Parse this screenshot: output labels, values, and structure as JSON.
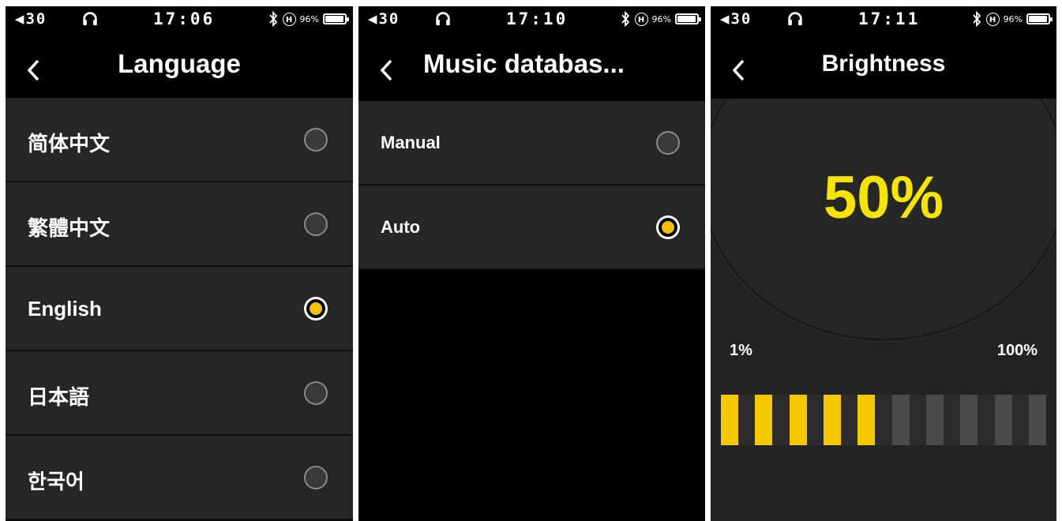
{
  "screens": [
    {
      "status": {
        "volume": "◀30",
        "time": "17:06",
        "battery_pct": "96%",
        "battery_level": 0.96
      },
      "title": "Language",
      "options": [
        {
          "label": "简体中文",
          "selected": false
        },
        {
          "label": "繁體中文",
          "selected": false
        },
        {
          "label": "English",
          "selected": true
        },
        {
          "label": "日本語",
          "selected": false
        },
        {
          "label": "한국어",
          "selected": false
        }
      ]
    },
    {
      "status": {
        "volume": "◀30",
        "time": "17:10",
        "battery_pct": "96%",
        "battery_level": 0.96
      },
      "title": "Music databas...",
      "options": [
        {
          "label": "Manual",
          "selected": false
        },
        {
          "label": "Auto",
          "selected": true
        }
      ]
    },
    {
      "status": {
        "volume": "◀30",
        "time": "17:11",
        "battery_pct": "96%",
        "battery_level": 0.96
      },
      "title": "Brightness",
      "value_label": "50%",
      "min_label": "1%",
      "max_label": "100%",
      "level_segments_total": 10,
      "level_segments_on": 5
    }
  ],
  "colors": {
    "accent": "#f5c000",
    "value_text": "#f5e400",
    "row_bg": "#262626",
    "bg": "#000000"
  },
  "icons": [
    "volume-icon",
    "headphones-icon",
    "bluetooth-icon",
    "hires-icon",
    "battery-icon",
    "back-icon",
    "radio-icon"
  ]
}
